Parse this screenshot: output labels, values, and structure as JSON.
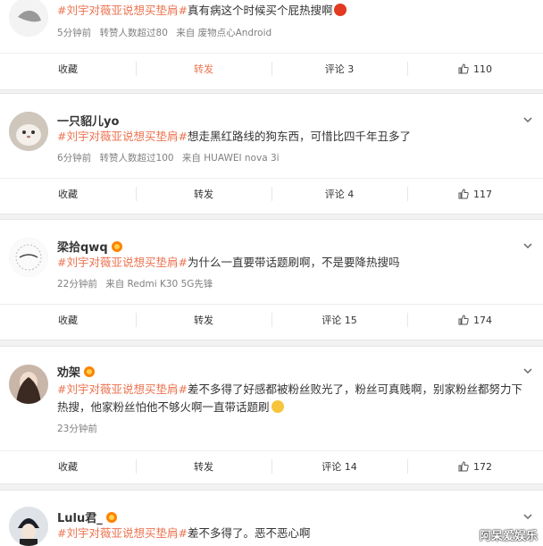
{
  "topic": "#刘宇对薇亚说想买垫肩#",
  "posts": [
    {
      "name": "",
      "text": "真有病这个时候买个屁热搜啊",
      "meta": [
        "5分钟前",
        "转赞人数超过80",
        "来自 废物点心Android"
      ],
      "actions": {
        "collect": "收藏",
        "retweet": "转发",
        "comment": "评论 3",
        "like": "110"
      }
    },
    {
      "name": "一只貂儿yo",
      "text": "想走黑红路线的狗东西，可惜比四千年丑多了",
      "meta": [
        "6分钟前",
        "转赞人数超过100",
        "来自 HUAWEI nova 3i"
      ],
      "actions": {
        "collect": "收藏",
        "retweet": "转发",
        "comment": "评论 4",
        "like": "117"
      }
    },
    {
      "name": "梁拾qwq",
      "text": "为什么一直要带话题刷啊，不是要降热搜吗",
      "meta": [
        "22分钟前",
        "来自 Redmi K30 5G先锋"
      ],
      "actions": {
        "collect": "收藏",
        "retweet": "转发",
        "comment": "评论 15",
        "like": "174"
      }
    },
    {
      "name": "劝架",
      "text": "差不多得了好感都被粉丝败光了，粉丝可真贱啊，别家粉丝都努力下热搜，他家粉丝怕他不够火啊一直带话题刷",
      "meta": [
        "23分钟前"
      ],
      "actions": {
        "collect": "收藏",
        "retweet": "转发",
        "comment": "评论 14",
        "like": "172"
      }
    },
    {
      "name": "Lulu君_",
      "text": "差不多得了。恶不恶心啊",
      "meta": [],
      "actions": {}
    }
  ],
  "watermark": "阿呆爱娱乐",
  "icons": {
    "more": "chevron-down-icon",
    "like": "thumbs-up-icon",
    "vip": "vip-badge-icon"
  },
  "colors": {
    "topic": "#eb7350",
    "retweet_active": "#eb7350",
    "meta": "#808080"
  }
}
